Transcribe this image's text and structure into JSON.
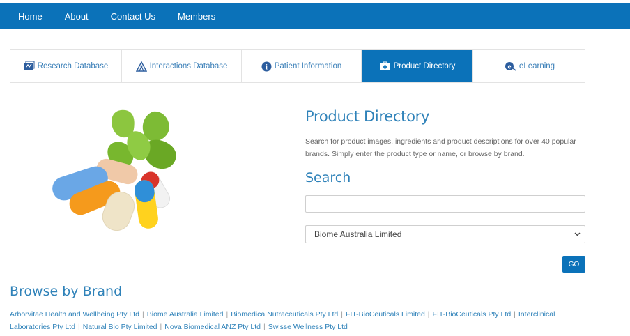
{
  "topnav": {
    "items": [
      {
        "label": "Home"
      },
      {
        "label": "About"
      },
      {
        "label": "Contact Us"
      },
      {
        "label": "Members"
      }
    ]
  },
  "tabs": [
    {
      "label": "Research Database",
      "icon": "research-database-icon",
      "active": false
    },
    {
      "label": "Interactions Database",
      "icon": "interactions-icon",
      "active": false
    },
    {
      "label": "Patient Information",
      "icon": "info-icon",
      "active": false
    },
    {
      "label": "Product Directory",
      "icon": "medical-kit-icon",
      "active": true
    },
    {
      "label": "eLearning",
      "icon": "elearning-icon",
      "active": false
    }
  ],
  "product_directory": {
    "title": "Product Directory",
    "description": "Search for product images, ingredients and product descriptions for over 40 popular brands. Simply enter the product type or name, or browse by brand."
  },
  "search": {
    "title": "Search",
    "input_value": "",
    "brand_selected": "Biome Australia Limited",
    "go_label": "GO"
  },
  "browse": {
    "title": "Browse by Brand",
    "brands": [
      "Arborvitae Health and Wellbeing Pty Ltd",
      "Biome Australia Limited",
      "Biomedica Nutraceuticals Pty Ltd",
      "FIT-BioCeuticals Limited",
      "FIT-BioCeuticals Pty Ltd",
      "Interclinical Laboratories Pty Ltd",
      "Natural Bio Pty Limited",
      "Nova Biomedical ANZ Pty Ltd",
      "Swisse Wellness Pty Ltd"
    ],
    "separator": "|"
  },
  "colors": {
    "brand_blue": "#0b72b9",
    "heading_blue": "#2f82b9"
  }
}
